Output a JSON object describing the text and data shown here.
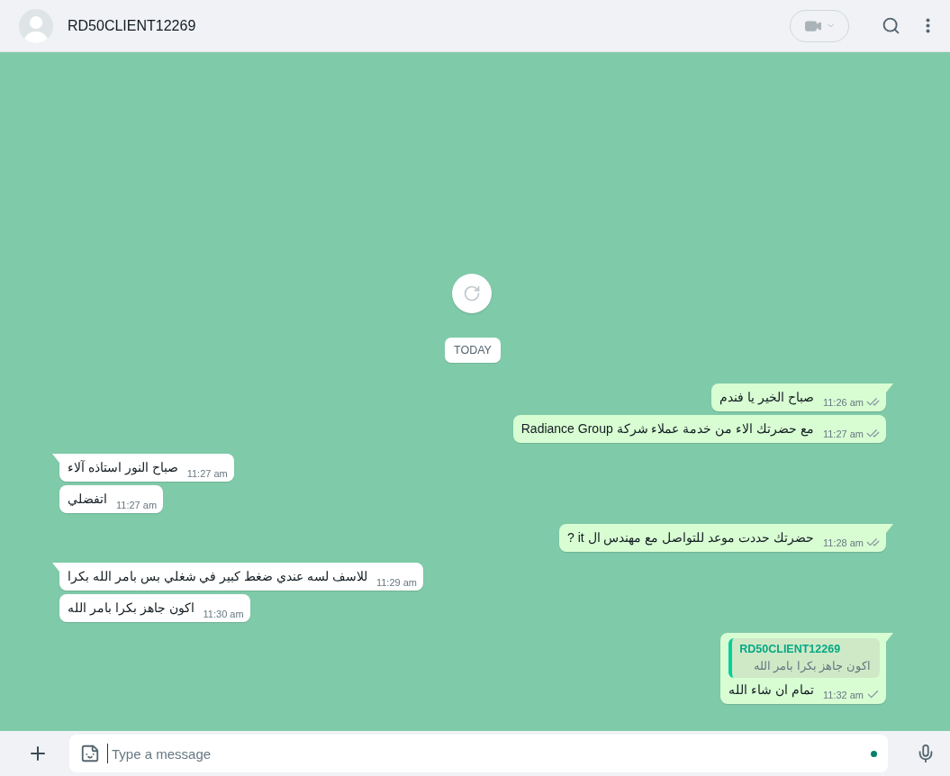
{
  "header": {
    "contact_name": "RD50CLIENT12269"
  },
  "date_chip": "TODAY",
  "messages": [
    {
      "outgoing": true,
      "tail": true,
      "text": "صباح الخير يا فندم",
      "time": "11:26 am",
      "double_check": true
    },
    {
      "outgoing": true,
      "tail": false,
      "text": "مع حضرتك الاء من خدمة عملاء شركة Radiance Group",
      "time": "11:27 am",
      "double_check": true
    },
    {
      "outgoing": false,
      "tail": true,
      "text": "صباح النور استاذه آلاء",
      "time": "11:27 am"
    },
    {
      "outgoing": false,
      "tail": false,
      "text": "اتفضلي",
      "time": "11:27 am"
    },
    {
      "outgoing": true,
      "tail": true,
      "text": "حضرتك حددت موعد للتواصل مع مهندس ال it ?",
      "time": "11:28 am",
      "double_check": true
    },
    {
      "outgoing": false,
      "tail": true,
      "text": "للاسف لسه عندي ضغط كبير في شغلي بس بامر الله بكرا",
      "time": "11:29 am"
    },
    {
      "outgoing": false,
      "tail": false,
      "text": "اكون جاهز بكرا بامر الله",
      "time": "11:30 am"
    },
    {
      "outgoing": true,
      "tail": true,
      "quote": {
        "author": "RD50CLIENT12269",
        "text": "اكون جاهز بكرا بامر الله"
      },
      "text": "تمام ان شاء الله",
      "time": "11:32 am",
      "double_check": false
    }
  ],
  "composer": {
    "placeholder": "Type a message"
  }
}
